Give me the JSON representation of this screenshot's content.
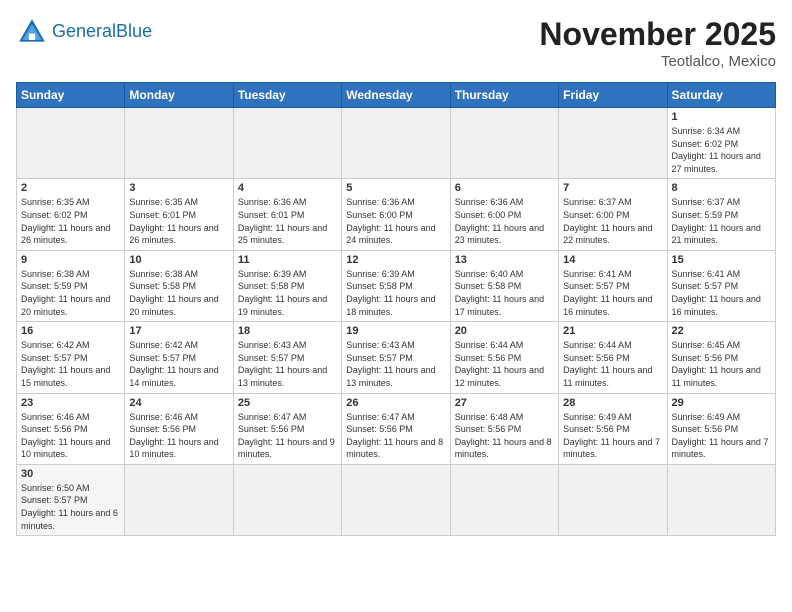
{
  "header": {
    "logo_general": "General",
    "logo_blue": "Blue",
    "month": "November 2025",
    "location": "Teotlalco, Mexico"
  },
  "days_of_week": [
    "Sunday",
    "Monday",
    "Tuesday",
    "Wednesday",
    "Thursday",
    "Friday",
    "Saturday"
  ],
  "weeks": [
    [
      {
        "day": "",
        "info": ""
      },
      {
        "day": "",
        "info": ""
      },
      {
        "day": "",
        "info": ""
      },
      {
        "day": "",
        "info": ""
      },
      {
        "day": "",
        "info": ""
      },
      {
        "day": "",
        "info": ""
      },
      {
        "day": "1",
        "info": "Sunrise: 6:34 AM\nSunset: 6:02 PM\nDaylight: 11 hours\nand 27 minutes."
      }
    ],
    [
      {
        "day": "2",
        "info": "Sunrise: 6:35 AM\nSunset: 6:02 PM\nDaylight: 11 hours\nand 26 minutes."
      },
      {
        "day": "3",
        "info": "Sunrise: 6:35 AM\nSunset: 6:01 PM\nDaylight: 11 hours\nand 26 minutes."
      },
      {
        "day": "4",
        "info": "Sunrise: 6:36 AM\nSunset: 6:01 PM\nDaylight: 11 hours\nand 25 minutes."
      },
      {
        "day": "5",
        "info": "Sunrise: 6:36 AM\nSunset: 6:00 PM\nDaylight: 11 hours\nand 24 minutes."
      },
      {
        "day": "6",
        "info": "Sunrise: 6:36 AM\nSunset: 6:00 PM\nDaylight: 11 hours\nand 23 minutes."
      },
      {
        "day": "7",
        "info": "Sunrise: 6:37 AM\nSunset: 6:00 PM\nDaylight: 11 hours\nand 22 minutes."
      },
      {
        "day": "8",
        "info": "Sunrise: 6:37 AM\nSunset: 5:59 PM\nDaylight: 11 hours\nand 21 minutes."
      }
    ],
    [
      {
        "day": "9",
        "info": "Sunrise: 6:38 AM\nSunset: 5:59 PM\nDaylight: 11 hours\nand 20 minutes."
      },
      {
        "day": "10",
        "info": "Sunrise: 6:38 AM\nSunset: 5:58 PM\nDaylight: 11 hours\nand 20 minutes."
      },
      {
        "day": "11",
        "info": "Sunrise: 6:39 AM\nSunset: 5:58 PM\nDaylight: 11 hours\nand 19 minutes."
      },
      {
        "day": "12",
        "info": "Sunrise: 6:39 AM\nSunset: 5:58 PM\nDaylight: 11 hours\nand 18 minutes."
      },
      {
        "day": "13",
        "info": "Sunrise: 6:40 AM\nSunset: 5:58 PM\nDaylight: 11 hours\nand 17 minutes."
      },
      {
        "day": "14",
        "info": "Sunrise: 6:41 AM\nSunset: 5:57 PM\nDaylight: 11 hours\nand 16 minutes."
      },
      {
        "day": "15",
        "info": "Sunrise: 6:41 AM\nSunset: 5:57 PM\nDaylight: 11 hours\nand 16 minutes."
      }
    ],
    [
      {
        "day": "16",
        "info": "Sunrise: 6:42 AM\nSunset: 5:57 PM\nDaylight: 11 hours\nand 15 minutes."
      },
      {
        "day": "17",
        "info": "Sunrise: 6:42 AM\nSunset: 5:57 PM\nDaylight: 11 hours\nand 14 minutes."
      },
      {
        "day": "18",
        "info": "Sunrise: 6:43 AM\nSunset: 5:57 PM\nDaylight: 11 hours\nand 13 minutes."
      },
      {
        "day": "19",
        "info": "Sunrise: 6:43 AM\nSunset: 5:57 PM\nDaylight: 11 hours\nand 13 minutes."
      },
      {
        "day": "20",
        "info": "Sunrise: 6:44 AM\nSunset: 5:56 PM\nDaylight: 11 hours\nand 12 minutes."
      },
      {
        "day": "21",
        "info": "Sunrise: 6:44 AM\nSunset: 5:56 PM\nDaylight: 11 hours\nand 11 minutes."
      },
      {
        "day": "22",
        "info": "Sunrise: 6:45 AM\nSunset: 5:56 PM\nDaylight: 11 hours\nand 11 minutes."
      }
    ],
    [
      {
        "day": "23",
        "info": "Sunrise: 6:46 AM\nSunset: 5:56 PM\nDaylight: 11 hours\nand 10 minutes."
      },
      {
        "day": "24",
        "info": "Sunrise: 6:46 AM\nSunset: 5:56 PM\nDaylight: 11 hours\nand 10 minutes."
      },
      {
        "day": "25",
        "info": "Sunrise: 6:47 AM\nSunset: 5:56 PM\nDaylight: 11 hours\nand 9 minutes."
      },
      {
        "day": "26",
        "info": "Sunrise: 6:47 AM\nSunset: 5:56 PM\nDaylight: 11 hours\nand 8 minutes."
      },
      {
        "day": "27",
        "info": "Sunrise: 6:48 AM\nSunset: 5:56 PM\nDaylight: 11 hours\nand 8 minutes."
      },
      {
        "day": "28",
        "info": "Sunrise: 6:49 AM\nSunset: 5:56 PM\nDaylight: 11 hours\nand 7 minutes."
      },
      {
        "day": "29",
        "info": "Sunrise: 6:49 AM\nSunset: 5:56 PM\nDaylight: 11 hours\nand 7 minutes."
      }
    ],
    [
      {
        "day": "30",
        "info": "Sunrise: 6:50 AM\nSunset: 5:57 PM\nDaylight: 11 hours\nand 6 minutes."
      },
      {
        "day": "",
        "info": ""
      },
      {
        "day": "",
        "info": ""
      },
      {
        "day": "",
        "info": ""
      },
      {
        "day": "",
        "info": ""
      },
      {
        "day": "",
        "info": ""
      },
      {
        "day": "",
        "info": ""
      }
    ]
  ]
}
